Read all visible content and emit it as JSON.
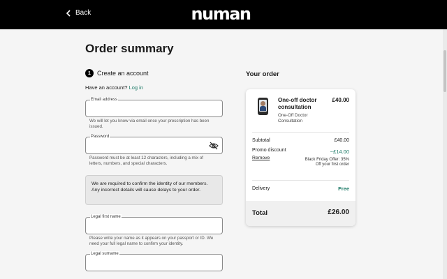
{
  "header": {
    "back_label": "Back",
    "logo_text": "numan"
  },
  "page_title": "Order summary",
  "step": {
    "number": "1",
    "label": "Create an account"
  },
  "have_account": {
    "text": "Have an account?",
    "link": "Log in"
  },
  "email": {
    "label": "Email address",
    "value": "",
    "help": "We will let you know via email once your prescription has been issued."
  },
  "password": {
    "label": "Password",
    "value": "",
    "help": "Password must be at least 12 characters, including a mix of letters, numbers, and special characters."
  },
  "identity_notice": "We are required to confirm the identity of our members. Any incorrect details will cause delays to your order.",
  "first_name": {
    "label": "Legal first name",
    "value": "",
    "help": "Please write your name as it appears on your passport or ID. We need your full legal name to confirm your identity."
  },
  "surname": {
    "label": "Legal surname",
    "value": ""
  },
  "order": {
    "heading": "Your order",
    "product_name": "One-off doctor consultation",
    "product_sub": "One-Off Doctor Consultation",
    "product_price": "£40.00",
    "subtotal_label": "Subtotal",
    "subtotal_value": "£40.00",
    "promo_label": "Promo discount",
    "promo_value": "−£14.00",
    "remove_label": "Remove",
    "offer_note": "Black Friday Offer: 35% Off your first order",
    "delivery_label": "Delivery",
    "delivery_value": "Free",
    "total_label": "Total",
    "total_value": "£26.00"
  },
  "colors": {
    "accent": "#1d7a67",
    "header_bg": "#000000",
    "page_bg": "#f5f5f5"
  },
  "icons": {
    "back": "chevron-left-icon",
    "password_toggle": "eye-slash-icon"
  }
}
